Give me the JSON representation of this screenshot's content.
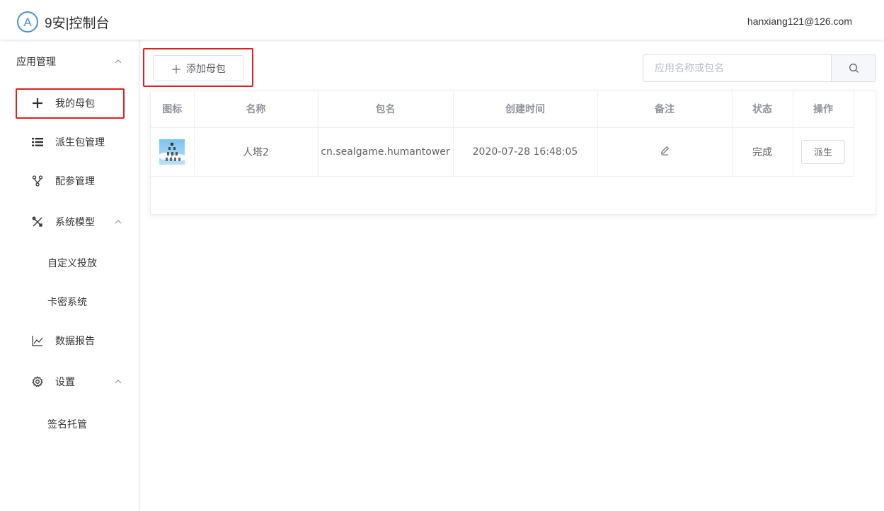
{
  "header": {
    "logo_letter": "A",
    "title": "9安|控制台",
    "user_email": "hanxiang121@126.com"
  },
  "sidebar": {
    "group_app": "应用管理",
    "items": [
      {
        "label": "我的母包",
        "icon": "plus-icon"
      },
      {
        "label": "派生包管理",
        "icon": "list-icon"
      },
      {
        "label": "配参管理",
        "icon": "branch-icon"
      },
      {
        "label": "系统模型",
        "icon": "tools-icon"
      },
      {
        "label": "自定义投放"
      },
      {
        "label": "卡密系统"
      },
      {
        "label": "数据报告",
        "icon": "chart-line-icon"
      },
      {
        "label": "设置",
        "icon": "gear-icon"
      },
      {
        "label": "签名托管"
      }
    ]
  },
  "toolbar": {
    "add_label": "添加母包",
    "search_placeholder": "应用名称或包名"
  },
  "table": {
    "columns": [
      "图标",
      "名称",
      "包名",
      "创建时间",
      "备注",
      "状态",
      "操作"
    ],
    "rows": [
      {
        "name": "人塔2",
        "package": "cn.sealgame.humantower",
        "created": "2020-07-28 16:48:05",
        "status": "完成",
        "action": "派生"
      }
    ]
  },
  "colors": {
    "accent": "#4a90d9",
    "highlight": "#e02020"
  }
}
